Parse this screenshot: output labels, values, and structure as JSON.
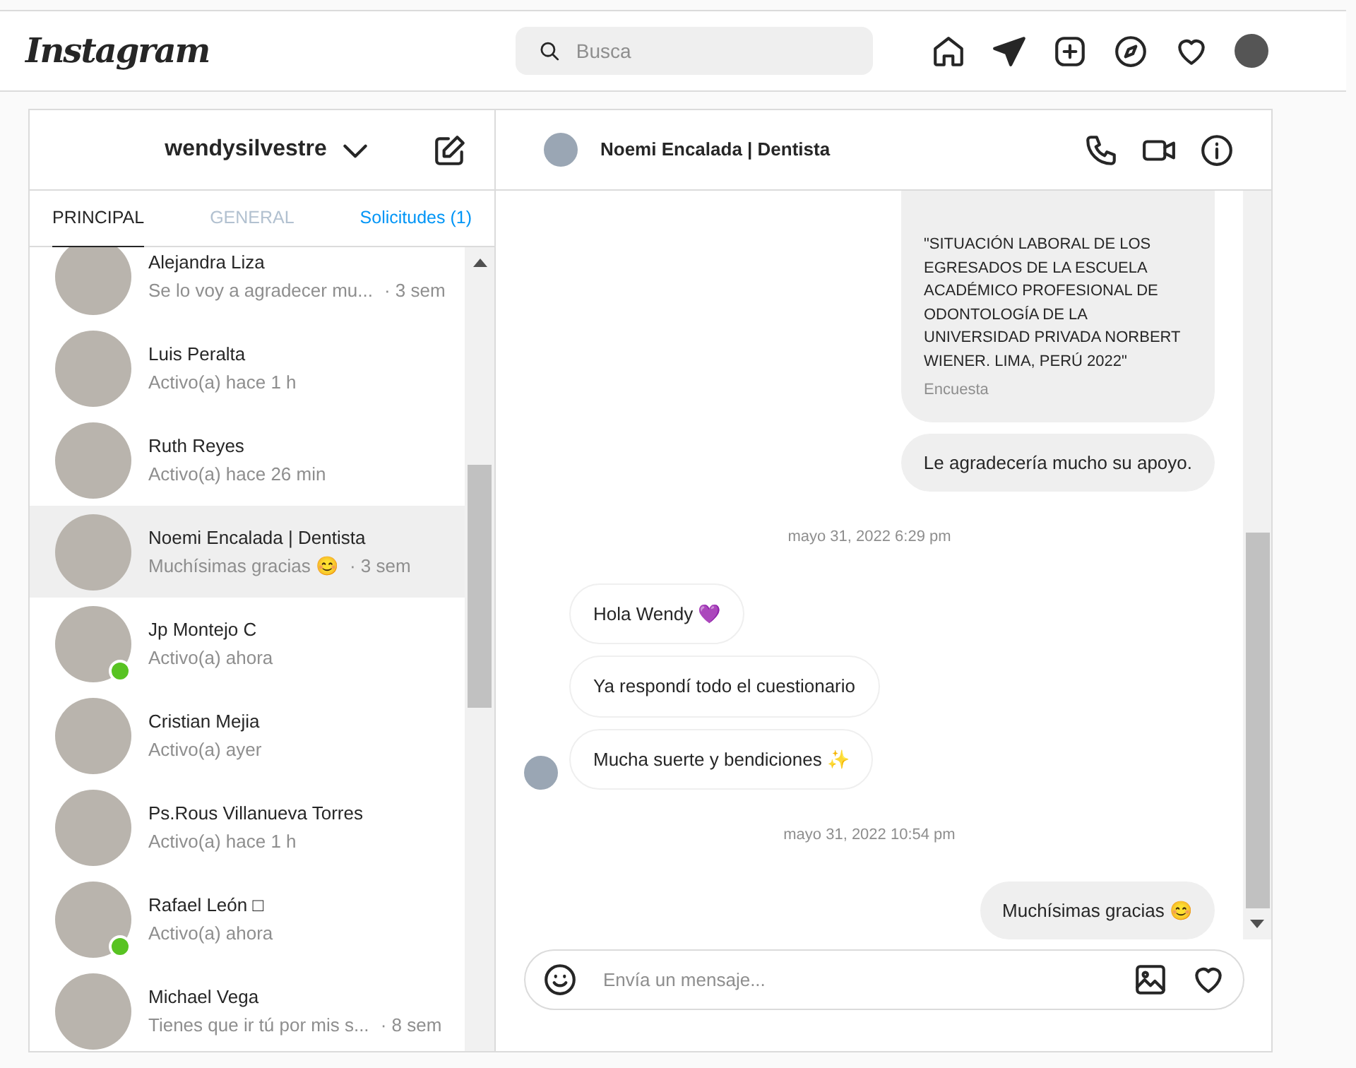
{
  "topbar": {
    "logo": "Instagram",
    "search": {
      "placeholder": "Busca"
    }
  },
  "inbox": {
    "username": "wendysilvestre",
    "tabs": [
      {
        "label": "PRINCIPAL",
        "selected": true,
        "kind": "tab"
      },
      {
        "label": "GENERAL",
        "selected": false,
        "kind": "tab"
      },
      {
        "label": "Solicitudes (1)",
        "selected": false,
        "kind": "link"
      }
    ],
    "conversations": [
      {
        "name": "Alejandra Liza",
        "preview": "Se lo voy a agradecer mu...",
        "time": "· 3 sem",
        "selected": false,
        "online": false
      },
      {
        "name": "Luis Peralta",
        "preview": "Activo(a) hace 1 h",
        "selected": false,
        "online": false
      },
      {
        "name": "Ruth Reyes",
        "preview": "Activo(a) hace 26 min",
        "selected": false,
        "online": false
      },
      {
        "name": "Noemi Encalada | Dentista",
        "preview": "Muchísimas gracias 😊",
        "time": "· 3 sem",
        "selected": true,
        "online": false
      },
      {
        "name": "Jp Montejo C",
        "preview": "Activo(a) ahora",
        "selected": false,
        "online": true
      },
      {
        "name": "Cristian Mejia",
        "preview": "Activo(a) ayer",
        "selected": false,
        "online": false
      },
      {
        "name": "Ps.Rous Villanueva Torres",
        "preview": "Activo(a) hace 1 h",
        "selected": false,
        "online": false
      },
      {
        "name": "Rafael León □",
        "preview": "Activo(a) ahora",
        "selected": false,
        "online": true
      },
      {
        "name": "Michael Vega",
        "preview": "Tienes que ir tú por mis s...",
        "time": "· 8 sem",
        "selected": false,
        "online": false
      }
    ]
  },
  "chat": {
    "contact": "Noemi Encalada | Dentista",
    "messages": [
      {
        "kind": "survey",
        "text": "\"SITUACIÓN LABORAL DE LOS EGRESADOS DE LA ESCUELA ACADÉMICO PROFESIONAL DE ODONTOLOGÍA DE LA UNIVERSIDAD PRIVADA NORBERT WIENER. LIMA, PERÚ 2022\"",
        "caption": "Encuesta"
      },
      {
        "kind": "outgoing",
        "text": "Le agradecería mucho su apoyo."
      },
      {
        "kind": "date",
        "text": "mayo 31, 2022 6:29 pm"
      },
      {
        "kind": "incoming",
        "text": "Hola Wendy 💜"
      },
      {
        "kind": "incoming",
        "text": "Ya respondí todo el cuestionario"
      },
      {
        "kind": "incoming",
        "text": "Mucha suerte y bendiciones ✨",
        "avatar": true
      },
      {
        "kind": "date",
        "text": "mayo 31, 2022 10:54 pm"
      },
      {
        "kind": "outgoing",
        "text": "Muchísimas gracias 😊"
      }
    ],
    "composer": {
      "placeholder": "Envía un mensaje..."
    }
  }
}
